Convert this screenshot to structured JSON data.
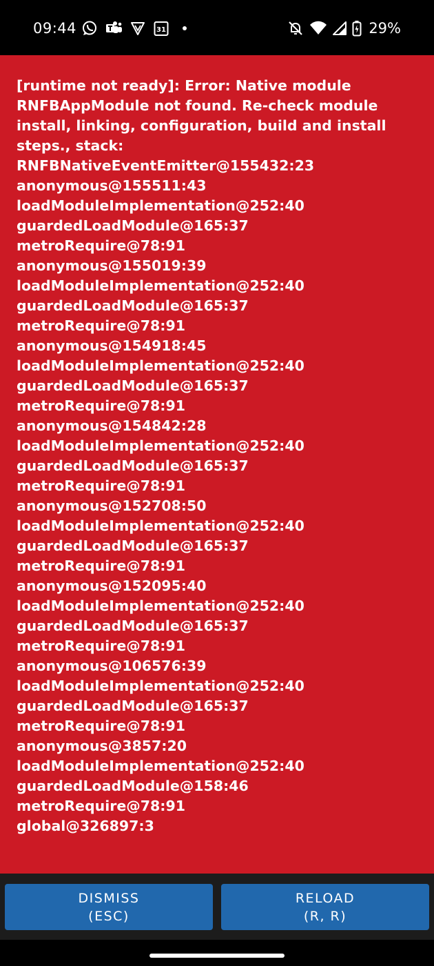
{
  "status_bar": {
    "time": "09:44",
    "left_icons": [
      "whatsapp-icon",
      "teams-icon",
      "vpn-shield-icon",
      "calendar-icon",
      "more-notifications-dot-icon"
    ],
    "calendar_day": "31",
    "right_icons": [
      "mute-icon",
      "wifi-icon",
      "cellular-signal-icon",
      "battery-icon"
    ],
    "battery_percent": "29%"
  },
  "redbox": {
    "background_color": "#cc1a25",
    "message": "[runtime not ready]: Error: Native module RNFBAppModule not found. Re-check module install, linking, configuration, build and install steps., stack:\nRNFBNativeEventEmitter@155432:23\nanonymous@155511:43\nloadModuleImplementation@252:40\nguardedLoadModule@165:37\nmetroRequire@78:91\nanonymous@155019:39\nloadModuleImplementation@252:40\nguardedLoadModule@165:37\nmetroRequire@78:91\nanonymous@154918:45\nloadModuleImplementation@252:40\nguardedLoadModule@165:37\nmetroRequire@78:91\nanonymous@154842:28\nloadModuleImplementation@252:40\nguardedLoadModule@165:37\nmetroRequire@78:91\nanonymous@152708:50\nloadModuleImplementation@252:40\nguardedLoadModule@165:37\nmetroRequire@78:91\nanonymous@152095:40\nloadModuleImplementation@252:40\nguardedLoadModule@165:37\nmetroRequire@78:91\nanonymous@106576:39\nloadModuleImplementation@252:40\nguardedLoadModule@165:37\nmetroRequire@78:91\nanonymous@3857:20\nloadModuleImplementation@252:40\nguardedLoadModule@158:46\nmetroRequire@78:91\nglobal@326897:3"
  },
  "buttons": {
    "button_color": "#2168ad",
    "dismiss": {
      "label": "DISMISS",
      "shortcut": "(ESC)"
    },
    "reload": {
      "label": "RELOAD",
      "shortcut": "(R, R)"
    }
  }
}
